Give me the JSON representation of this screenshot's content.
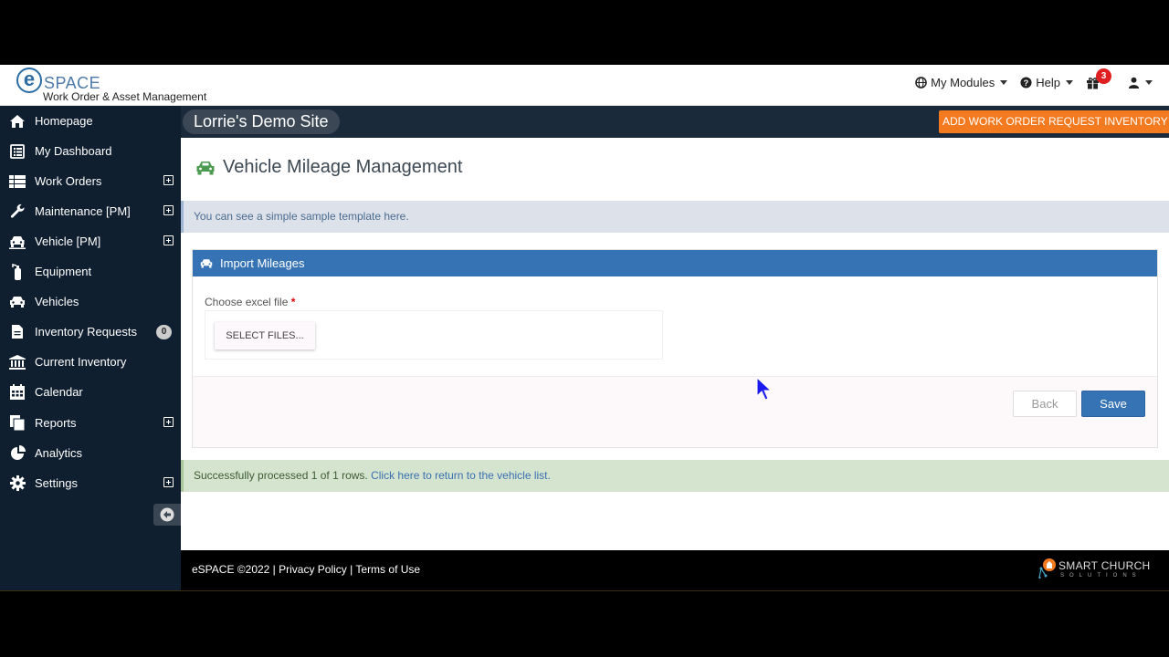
{
  "app": {
    "logo_e": "e",
    "logo_space": "SPACE",
    "logo_subtitle": "Work Order & Asset Management"
  },
  "topnav": {
    "modules_label": "My Modules",
    "help_label": "Help",
    "notifications_count": "3"
  },
  "sitebar": {
    "site_name": "Lorrie's Demo Site",
    "add_work_order_label": "ADD WORK ORDER",
    "request_inventory_label": "REQUEST INVENTORY"
  },
  "sidebar": {
    "items": [
      {
        "label": "Homepage",
        "icon": "home-icon",
        "expandable": false
      },
      {
        "label": "My Dashboard",
        "icon": "dashboard-icon",
        "expandable": false
      },
      {
        "label": "Work Orders",
        "icon": "list-icon",
        "expandable": true
      },
      {
        "label": "Maintenance [PM]",
        "icon": "wrench-icon",
        "expandable": true
      },
      {
        "label": "Vehicle [PM]",
        "icon": "vehicle-icon",
        "expandable": true
      },
      {
        "label": "Equipment",
        "icon": "extinguisher-icon",
        "expandable": false
      },
      {
        "label": "Vehicles",
        "icon": "car-icon",
        "expandable": false
      },
      {
        "label": "Inventory Requests",
        "icon": "document-icon",
        "count": "0"
      },
      {
        "label": "Current Inventory",
        "icon": "building-icon",
        "expandable": false
      },
      {
        "label": "Calendar",
        "icon": "calendar-icon",
        "expandable": false
      },
      {
        "label": "Reports",
        "icon": "reports-icon",
        "expandable": true
      },
      {
        "label": "Analytics",
        "icon": "pie-chart-icon",
        "expandable": false
      },
      {
        "label": "Settings",
        "icon": "gear-icon",
        "expandable": true
      }
    ]
  },
  "main": {
    "title": "Vehicle Mileage Management",
    "info_text": "You can see a simple sample template here.",
    "panel_title": "Import Mileages",
    "file_label": "Choose excel file",
    "required_mark": "*",
    "select_files_label": "SELECT FILES...",
    "back_label": "Back",
    "save_label": "Save",
    "success_text": "Successfully processed 1 of 1 rows. ",
    "success_link": "Click here to return to the vehicle list."
  },
  "footer": {
    "copyright": "eSPACE ©2022 | ",
    "privacy": "Privacy Policy",
    "separator": " | ",
    "terms": "Terms of Use",
    "brand_name": "SMART CHURCH",
    "brand_sub": "SOLUTIONS"
  },
  "colors": {
    "primary_blue": "#3673b5",
    "accent_orange": "#f47a20",
    "sidebar_bg": "#0f1f30",
    "success_bg": "#d5e4cf"
  }
}
